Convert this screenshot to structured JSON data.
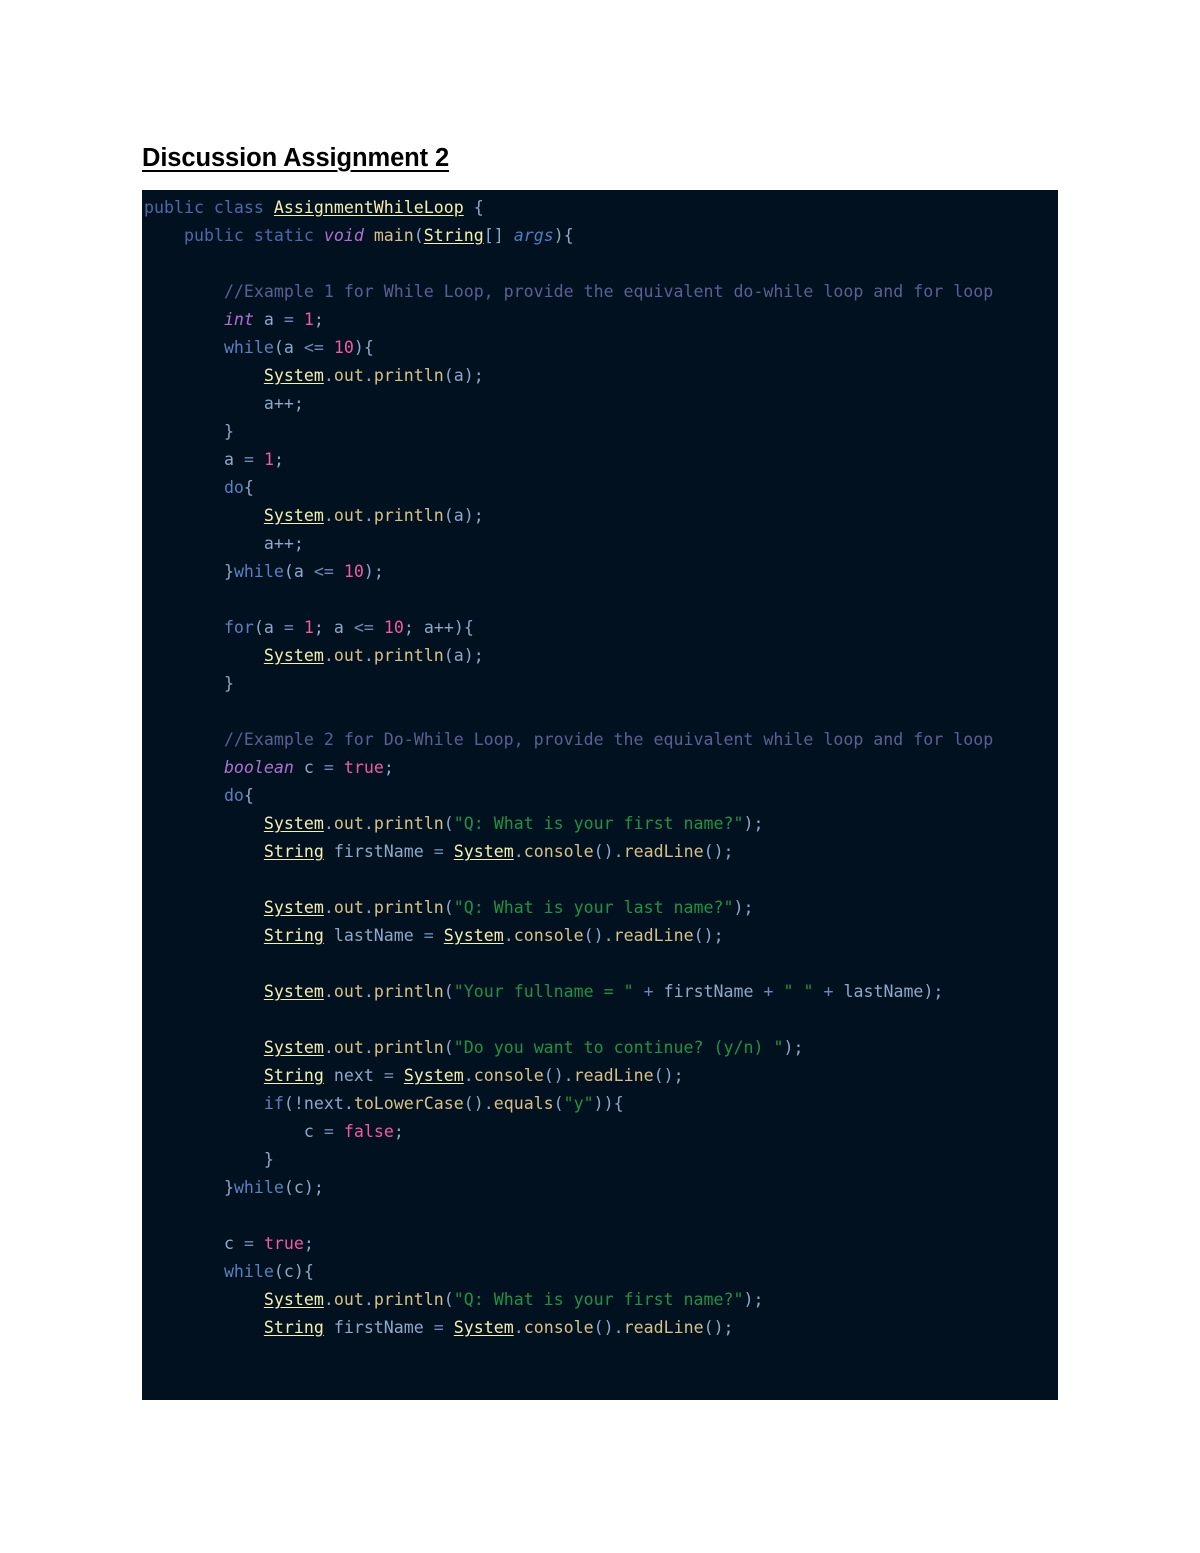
{
  "document": {
    "title": "Discussion Assignment 2",
    "language": "java",
    "background_color": "#ffffff"
  },
  "code_block": {
    "background_color": "#02111f",
    "theme_colors": {
      "keyword": "#4b6ba8",
      "type_italic": "#b070d0",
      "class_underlined": "#f5efb0",
      "method": "#d6c08a",
      "identifier": "#8fa8c8",
      "parameter_italic": "#4f7ec4",
      "number": "#ef5ba1",
      "string": "#1f9245",
      "comment": "#5b5f93"
    },
    "lines": [
      "public class AssignmentWhileLoop {",
      "    public static void main(String[] args){",
      "",
      "        //Example 1 for While Loop, provide the equivalent do-while loop and for loop",
      "        int a = 1;",
      "        while(a <= 10){",
      "            System.out.println(a);",
      "            a++;",
      "        }",
      "        a = 1;",
      "        do{",
      "            System.out.println(a);",
      "            a++;",
      "        }while(a <= 10);",
      "",
      "        for(a = 1; a <= 10; a++){",
      "            System.out.println(a);",
      "        }",
      "",
      "        //Example 2 for Do-While Loop, provide the equivalent while loop and for loop",
      "        boolean c = true;",
      "        do{",
      "            System.out.println(\"Q: What is your first name?\");",
      "            String firstName = System.console().readLine();",
      "",
      "            System.out.println(\"Q: What is your last name?\");",
      "            String lastName = System.console().readLine();",
      "",
      "            System.out.println(\"Your fullname = \" + firstName + \" \" + lastName);",
      "",
      "            System.out.println(\"Do you want to continue? (y/n) \");",
      "            String next = System.console().readLine();",
      "            if(!next.toLowerCase().equals(\"y\")){",
      "                c = false;",
      "            }",
      "        }while(c);",
      "",
      "        c = true;",
      "        while(c){",
      "            System.out.println(\"Q: What is your first name?\");",
      "            String firstName = System.console().readLine();"
    ]
  }
}
